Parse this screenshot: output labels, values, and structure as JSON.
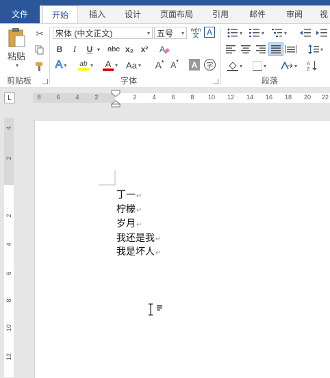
{
  "tabs": [
    "文件",
    "开始",
    "插入",
    "设计",
    "页面布局",
    "引用",
    "邮件",
    "审阅",
    "视"
  ],
  "clipboard": {
    "paste_label": "粘贴",
    "group_label": "剪贴板"
  },
  "font": {
    "family": "宋体 (中文正文)",
    "size": "五号",
    "phonetic": "wén",
    "phonetic_sub": "文",
    "bold": "B",
    "italic": "I",
    "underline": "U",
    "strike": "abc",
    "subscript": "x₂",
    "superscript": "x²",
    "case_label": "Aa",
    "grow": "A",
    "shrink": "A",
    "char_shading": "A",
    "enclose": "字",
    "highlight": "ab",
    "font_color": "A",
    "effects": "A",
    "group_label": "字体",
    "highlight_color": "#ffff00",
    "font_color_bar": "#e00000"
  },
  "paragraph": {
    "group_label": "段落"
  },
  "ruler": {
    "tab_marker": "L",
    "numbers": [
      "8",
      "6",
      "4",
      "2",
      "2",
      "4",
      "6",
      "8",
      "10",
      "12",
      "14",
      "16",
      "18",
      "20",
      "22"
    ],
    "vnumbers": [
      "4",
      "2",
      "2",
      "4",
      "6",
      "8",
      "10",
      "12"
    ]
  },
  "document": {
    "lines": [
      "丁一",
      "柠檬",
      "岁月",
      "我还是我",
      "我是坏人"
    ],
    "para_mark": "↵"
  },
  "colors": {
    "accent": "#2b579a"
  }
}
